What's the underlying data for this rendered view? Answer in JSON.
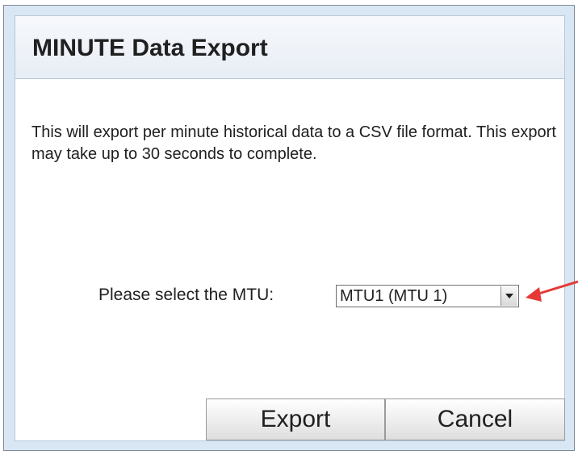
{
  "dialog": {
    "title": "MINUTE Data Export",
    "description": "This will export per minute historical data to a CSV file format. This export may take up to 30 seconds to complete.",
    "mtu_label": "Please select the MTU:",
    "mtu_select": {
      "value": "MTU1 (MTU 1)"
    },
    "buttons": {
      "export": "Export",
      "cancel": "Cancel"
    }
  },
  "annotation": {
    "arrow_color": "#e53935",
    "arrow_icon": "red-arrow-icon"
  },
  "colors": {
    "frame_bg": "#d9e6f4",
    "title_bar": "#eef2f8",
    "dialog_bg": "#ffffff"
  }
}
